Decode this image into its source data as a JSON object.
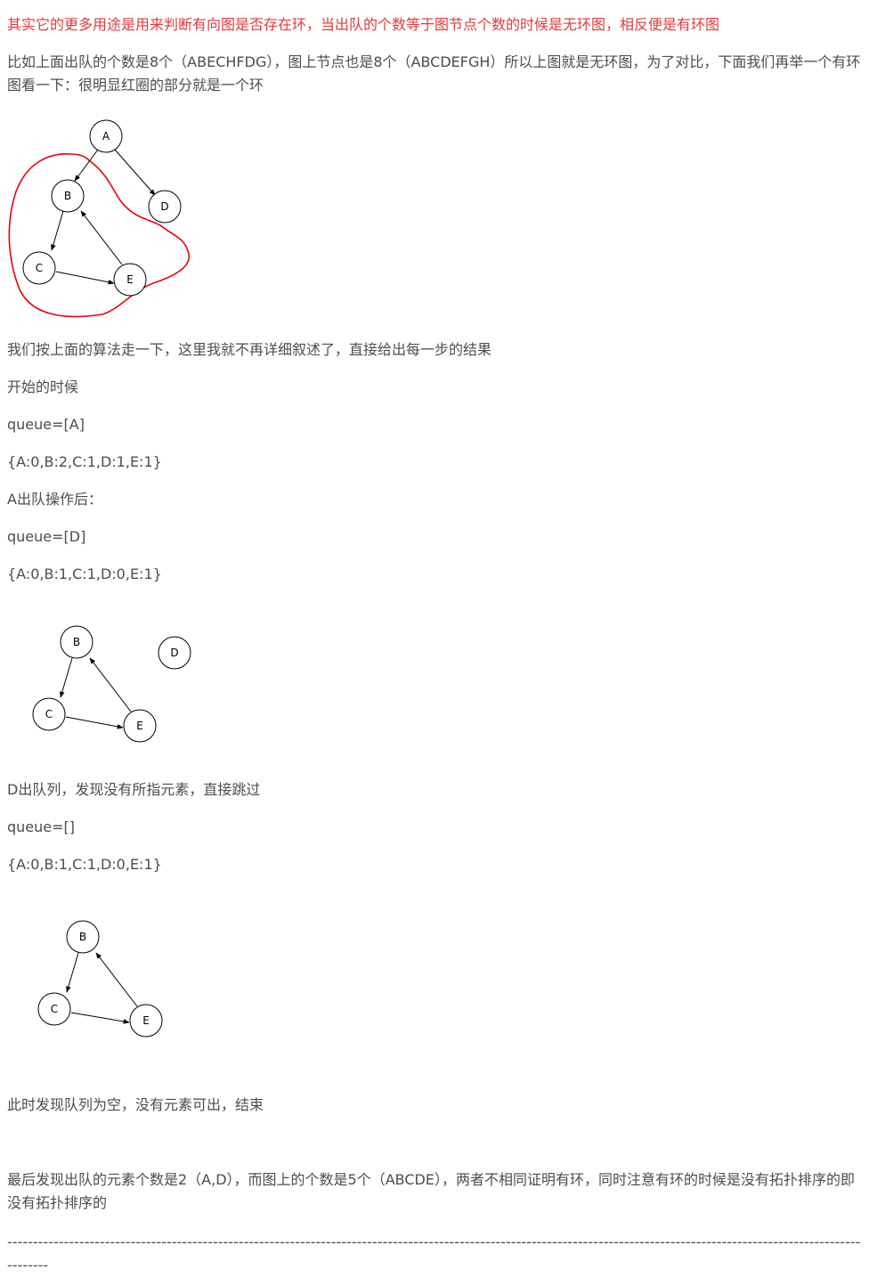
{
  "paragraphs": {
    "intro_red": "其实它的更多用途是用来判断有向图是否存在环，当出队的个数等于图节点个数的时候是无环图，相反便是有环图",
    "compare": "比如上面出队的个数是8个（ABECHFDG），图上节点也是8个（ABCDEFGH）所以上图就是无环图，为了对比，下面我们再举一个有环图看一下：很明显红圈的部分就是一个环",
    "walk": "我们按上面的算法走一下，这里我就不再详细叙述了，直接给出每一步的结果",
    "start": "开始的时候",
    "queue1": "queue=[A]",
    "degrees1": "{A:0,B:2,C:1,D:1,E:1}",
    "after_a": "A出队操作后：",
    "queue2": "queue=[D]",
    "degrees2": "{A:0,B:1,C:1,D:0,E:1}",
    "d_out": "D出队列，发现没有所指元素，直接跳过",
    "queue3": "queue=[]",
    "degrees3": "{A:0,B:1,C:1,D:0,E:1}",
    "empty": "此时发现队列为空，没有元素可出，结束",
    "conclusion": "最后发现出队的元素个数是2（A,D），而图上的个数是5个（ABCDE），两者不相同证明有环，同时注意有环的时候是没有拓扑排序的即没有拓扑排序的",
    "divider": "------------------------------------------------------------------------------------------------------------------------------------------------------------------------------"
  },
  "graphs": {
    "graph1": {
      "nodes": [
        "A",
        "B",
        "C",
        "D",
        "E"
      ]
    },
    "graph2": {
      "nodes": [
        "B",
        "C",
        "D",
        "E"
      ]
    },
    "graph3": {
      "nodes": [
        "B",
        "C",
        "E"
      ]
    }
  },
  "colors": {
    "text": "#4d4d4d",
    "red_text": "#e4393c",
    "cycle_outline": "#e8000b"
  }
}
